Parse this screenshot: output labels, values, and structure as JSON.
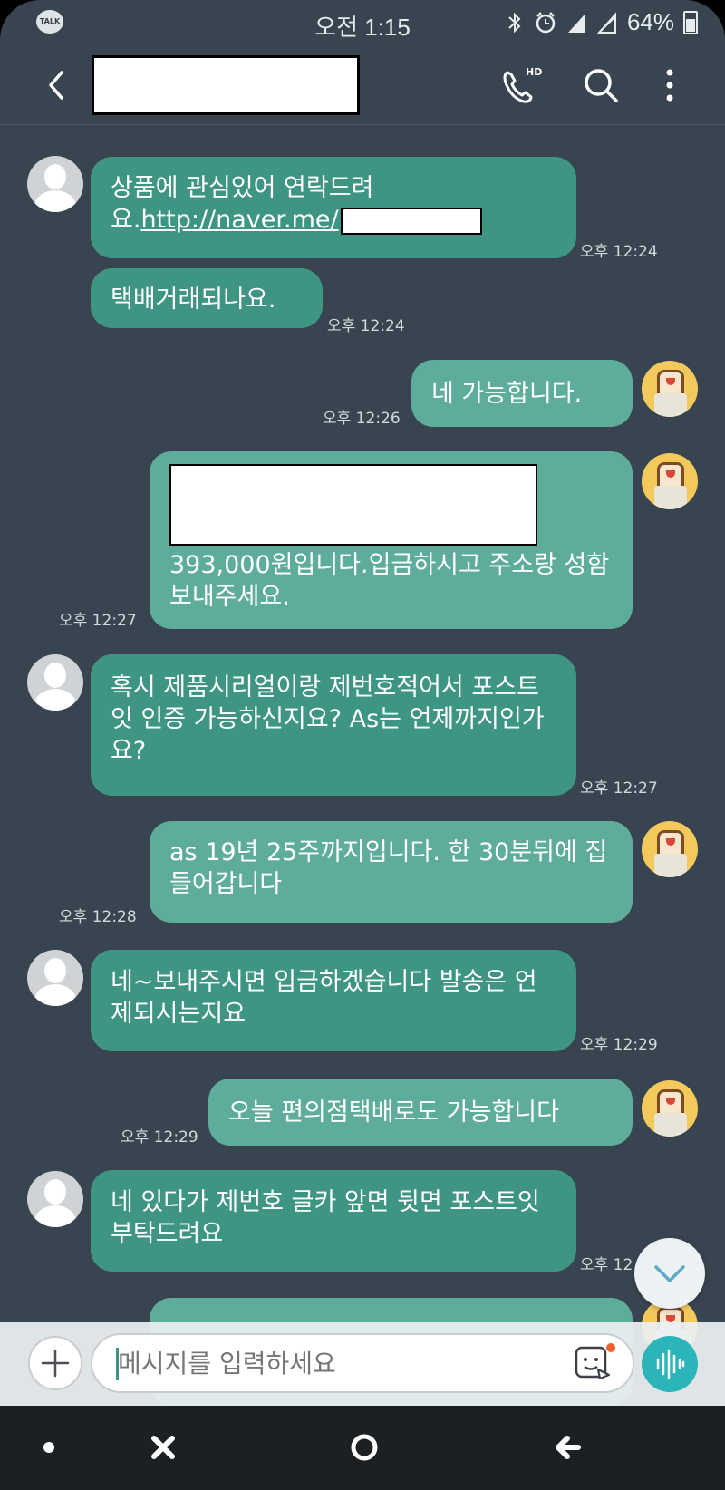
{
  "status_bar": {
    "app_badge": "TALK",
    "time": "오전 1:15",
    "battery": "64%"
  },
  "header": {
    "title": "",
    "hd_badge": "HD"
  },
  "messages": [
    {
      "side": "in",
      "text_before": "상품에 관심있어 연락드려요.",
      "link_text": "http://naver.me/",
      "time": "오후 12:24"
    },
    {
      "side": "in",
      "text": "택배거래되나요.",
      "time": "오후 12:24"
    },
    {
      "side": "out",
      "text": "네 가능합니다.",
      "time": "오후 12:26"
    },
    {
      "side": "out",
      "text": "393,000원입니다.입금하시고 주소랑 성함 보내주세요.",
      "time": "오후 12:27"
    },
    {
      "side": "in",
      "text": "혹시 제품시리얼이랑 제번호적어서 포스트잇 인증 가능하신지요? As는 언제까지인가요?",
      "time": "오후 12:27"
    },
    {
      "side": "out",
      "text": "as 19년 25주까지입니다. 한 30분뒤에 집들어갑니다",
      "time": "오후 12:28"
    },
    {
      "side": "in",
      "text": "네~보내주시면 입금하겠습니다 발송은 언제되시는지요",
      "time": "오후 12:29"
    },
    {
      "side": "out",
      "text": "오늘 편의점택배로도 가능합니다",
      "time": "오후 12:29"
    },
    {
      "side": "in",
      "text": "네 있다가 제번호 글카 앞면 뒷면 포스트잇 부탁드려요",
      "time": "오후 12"
    }
  ],
  "input": {
    "placeholder": "메시지를 입력하세요"
  },
  "colors": {
    "background": "#384550",
    "incoming_bubble": "#3f9583",
    "outgoing_bubble": "#5eac9b",
    "voice_button": "#2bb5b8"
  },
  "icons": [
    "talk-icon",
    "bluetooth-icon",
    "alarm-icon",
    "signal-icon",
    "battery-icon",
    "back-icon",
    "hd-call-icon",
    "search-icon",
    "more-icon",
    "chevron-down-icon",
    "plus-icon",
    "emoticon-icon",
    "voice-icon",
    "nav-dot-icon",
    "nav-close-icon",
    "nav-home-icon",
    "nav-back-icon"
  ]
}
